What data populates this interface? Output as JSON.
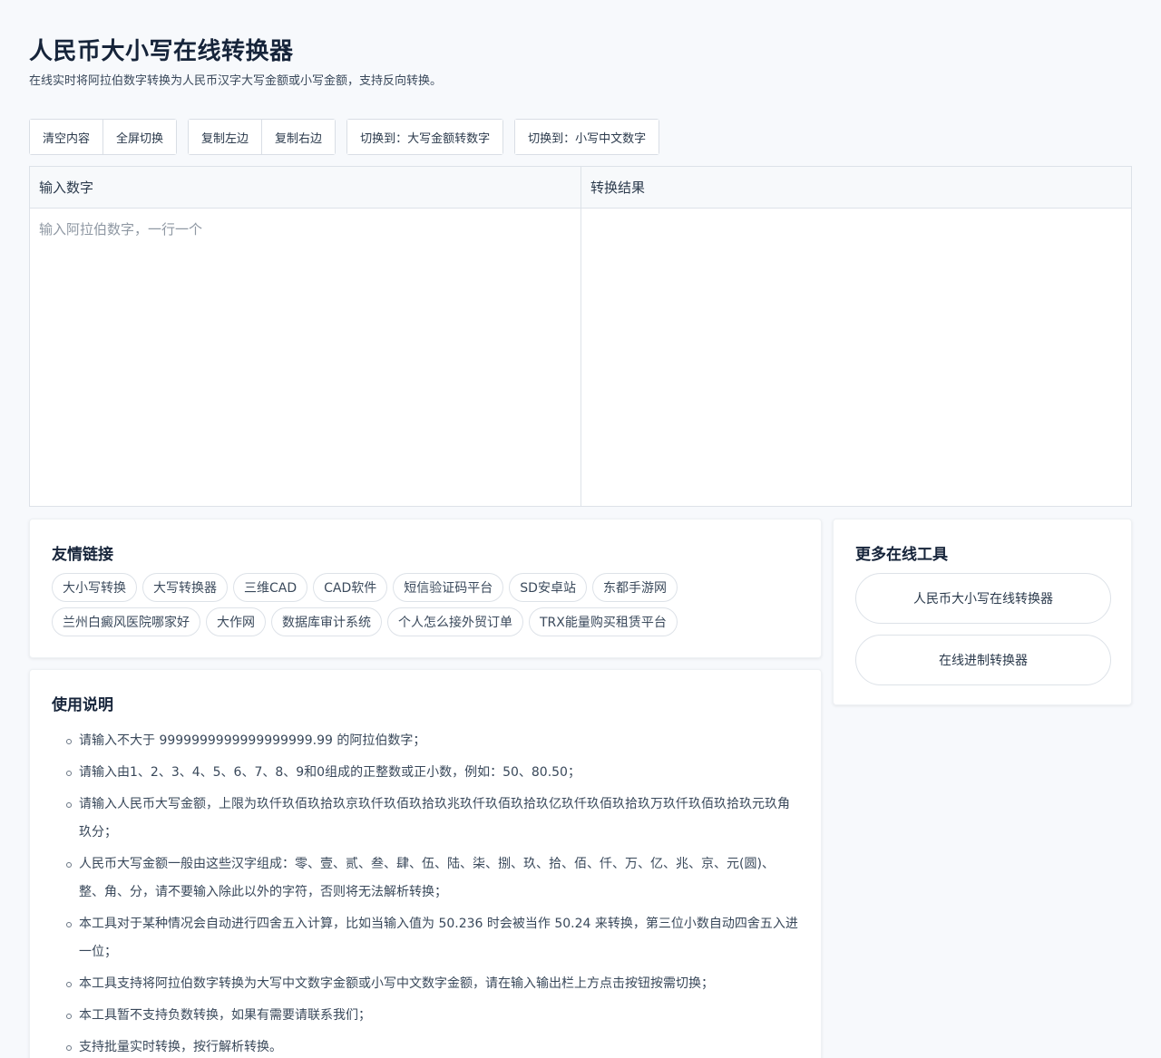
{
  "header": {
    "title": "人民币大小写在线转换器",
    "subtitle": "在线实时将阿拉伯数字转换为人民币汉字大写金额或小写金额，支持反向转换。"
  },
  "toolbar": {
    "clear": "清空内容",
    "fullscreen": "全屏切换",
    "copy_left": "复制左边",
    "copy_right": "复制右边",
    "switch_upper": "切换到：大写金额转数字",
    "switch_lower": "切换到：小写中文数字"
  },
  "editor": {
    "input_label": "输入数字",
    "input_placeholder": "输入阿拉伯数字，一行一个",
    "output_label": "转换结果"
  },
  "friend_links": {
    "title": "友情链接",
    "items": [
      "大小写转换",
      "大写转换器",
      "三维CAD",
      "CAD软件",
      "短信验证码平台",
      "SD安卓站",
      "东都手游网",
      "兰州白癜风医院哪家好",
      "大作网",
      "数据库审计系统",
      "个人怎么接外贸订单",
      "TRX能量购买租赁平台"
    ]
  },
  "more_tools": {
    "title": "更多在线工具",
    "items": [
      "人民币大小写在线转换器",
      "在线进制转换器"
    ]
  },
  "usage": {
    "title": "使用说明",
    "items": [
      "请输入不大于 9999999999999999999.99 的阿拉伯数字；",
      "请输入由1、2、3、4、5、6、7、8、9和0组成的正整数或正小数，例如：50、80.50；",
      "请输入人民币大写金额，上限为玖仟玖佰玖拾玖京玖仟玖佰玖拾玖兆玖仟玖佰玖拾玖亿玖仟玖佰玖拾玖万玖仟玖佰玖拾玖元玖角玖分；",
      "人民币大写金额一般由这些汉字组成：零、壹、贰、叁、肆、伍、陆、柒、捌、玖、拾、佰、仟、万、亿、兆、京、元(圆)、整、角、分，请不要输入除此以外的字符，否则将无法解析转换；",
      "本工具对于某种情况会自动进行四舍五入计算，比如当输入值为 50.236 时会被当作 50.24 来转换，第三位小数自动四舍五入进一位；",
      "本工具支持将阿拉伯数字转换为大写中文数字金额或小写中文数字金额，请在输入输出栏上方点击按钮按需切换；",
      "本工具暂不支持负数转换，如果有需要请联系我们；",
      "支持批量实时转换，按行解析转换。"
    ]
  }
}
